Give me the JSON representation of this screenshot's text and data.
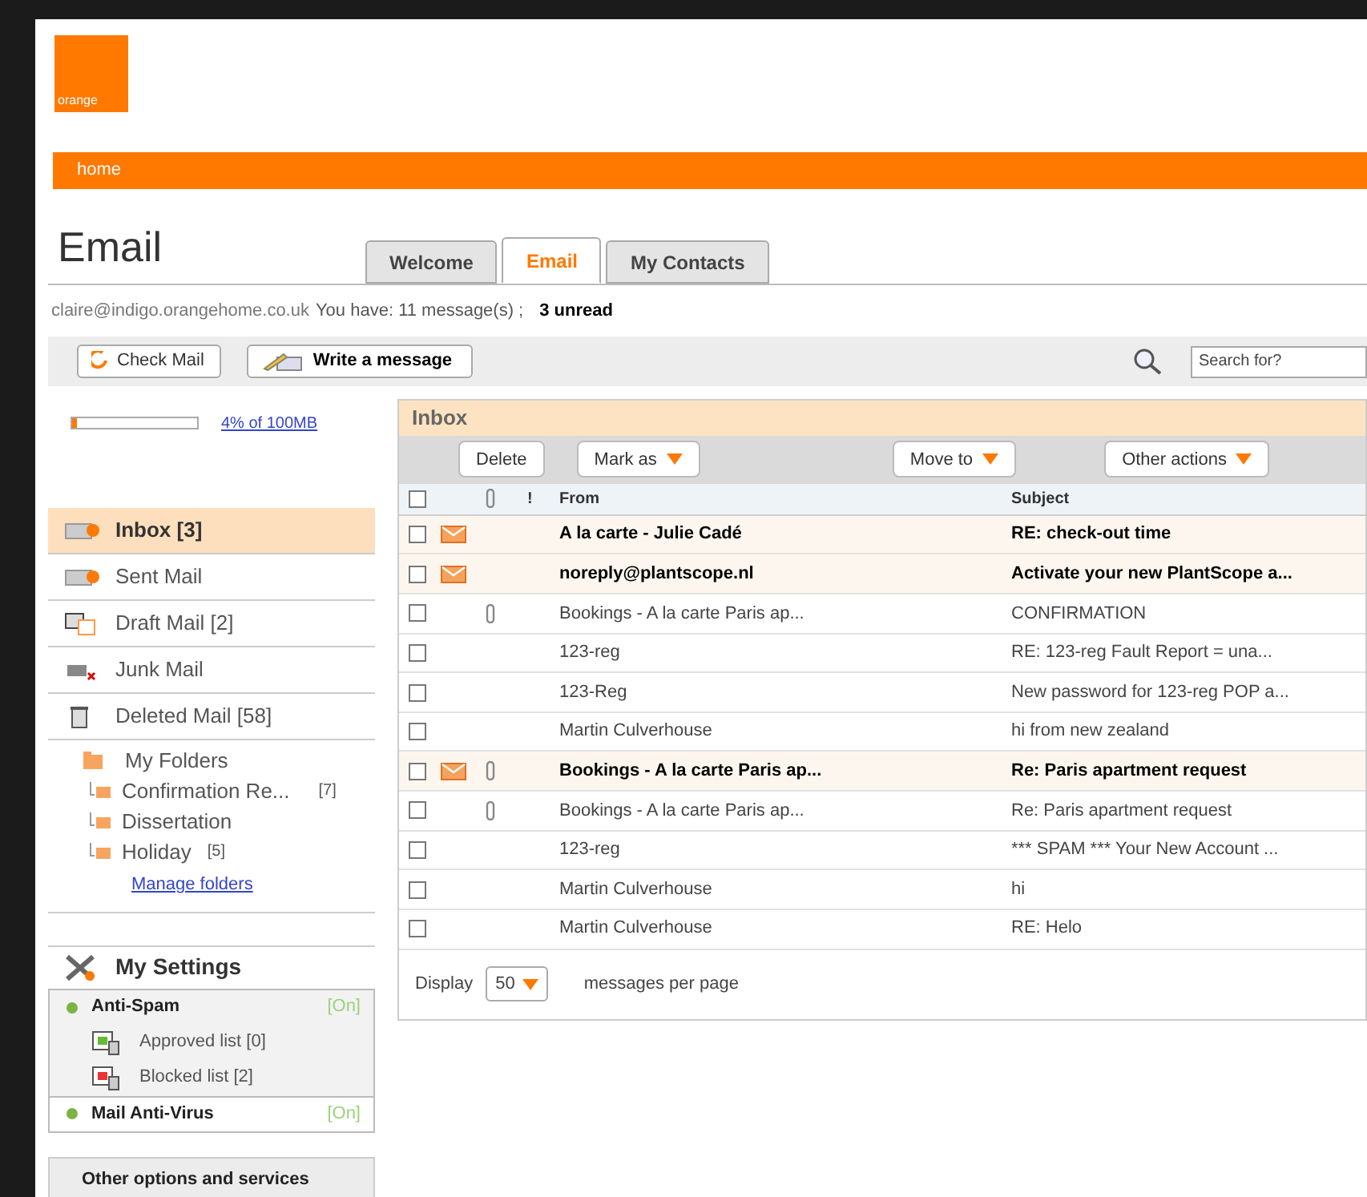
{
  "logo": {
    "text": "orange"
  },
  "nav": {
    "items": [
      "home"
    ]
  },
  "page_title": "Email",
  "tabs": [
    {
      "label": "Welcome",
      "selected": false
    },
    {
      "label": "Email",
      "selected": true
    },
    {
      "label": "My Contacts",
      "selected": false
    }
  ],
  "account_line": {
    "address": "claire@indigo.orangehome.co.uk",
    "text": "You have: 11 message(s) ;",
    "unread": "3 unread"
  },
  "toolbar": {
    "buttons": [
      {
        "kind": "check",
        "label": "Check Mail"
      },
      {
        "kind": "write",
        "label": "Write a message"
      }
    ],
    "search": {
      "placeholder": "Search for?"
    }
  },
  "quota": {
    "level": 0.04,
    "link": "4% of 100MB"
  },
  "folders": [
    {
      "kind": "inbox",
      "label": "Inbox",
      "count": "[3]",
      "selected": true
    },
    {
      "kind": "sent",
      "label": "Sent Mail",
      "selected": false
    },
    {
      "kind": "draft",
      "label": "Draft Mail",
      "count": "[2]",
      "selected": false
    },
    {
      "kind": "junk",
      "label": "Junk Mail",
      "selected": false
    },
    {
      "kind": "deleted",
      "label": "Deleted Mail",
      "count": "[58]",
      "selected": false
    }
  ],
  "my_folders": {
    "label": "My Folders",
    "children": [
      {
        "label": "Confirmation Re...",
        "count": "[7]"
      },
      {
        "label": "Dissertation"
      },
      {
        "label": "Holiday",
        "count": "[5]"
      }
    ],
    "manage_link": "Manage folders"
  },
  "settings": {
    "title": "My Settings",
    "items": [
      {
        "kind": "service",
        "label": "Anti-Spam",
        "status": "[On]"
      },
      {
        "kind": "approved",
        "label": "Approved list",
        "count": "[0]"
      },
      {
        "kind": "blocked",
        "label": "Blocked list",
        "count": "[2]"
      },
      {
        "kind": "service",
        "label": "Mail Anti-Virus",
        "status": "[On]"
      }
    ]
  },
  "other_options": "Other options and services",
  "inbox": {
    "title": "Inbox",
    "actions": [
      {
        "label": "Delete",
        "dropdown": false
      },
      {
        "label": "Mark as",
        "dropdown": true
      },
      {
        "label": "Move to",
        "dropdown": true
      },
      {
        "label": "Other actions",
        "dropdown": true
      }
    ],
    "columns": {
      "select_all_checked": false,
      "priority": "!",
      "from": "From",
      "subject": "Subject"
    },
    "rows": [
      {
        "checked": false,
        "unread": true,
        "attachment": false,
        "from": "A la carte - Julie Cadé",
        "subject": "RE: check-out time"
      },
      {
        "checked": false,
        "unread": true,
        "attachment": false,
        "from": "noreply@plantscope.nl",
        "subject": "Activate your new PlantScope a..."
      },
      {
        "checked": false,
        "unread": false,
        "attachment": true,
        "from": "Bookings - A la carte Paris ap...",
        "subject": "CONFIRMATION"
      },
      {
        "checked": false,
        "unread": false,
        "attachment": false,
        "from": "123-reg",
        "subject": "RE: 123-reg Fault Report = una..."
      },
      {
        "checked": false,
        "unread": false,
        "attachment": false,
        "from": "123-Reg",
        "subject": "New password for 123-reg POP a..."
      },
      {
        "checked": false,
        "unread": false,
        "attachment": false,
        "from": "Martin Culverhouse",
        "subject": "hi from new zealand"
      },
      {
        "checked": false,
        "unread": true,
        "attachment": true,
        "from": "Bookings - A la carte Paris ap...",
        "subject": "Re: Paris apartment request"
      },
      {
        "checked": false,
        "unread": false,
        "attachment": true,
        "from": "Bookings - A la carte Paris ap...",
        "subject": "Re: Paris apartment request"
      },
      {
        "checked": false,
        "unread": false,
        "attachment": false,
        "from": "123-reg",
        "subject": "*** SPAM *** Your New Account ..."
      },
      {
        "checked": false,
        "unread": false,
        "attachment": false,
        "from": "Martin Culverhouse",
        "subject": "hi"
      },
      {
        "checked": false,
        "unread": false,
        "attachment": false,
        "from": "Martin Culverhouse",
        "subject": "RE: Helo"
      }
    ],
    "footer": {
      "label": "Display",
      "per_page": "50",
      "suffix": "messages per page"
    }
  }
}
